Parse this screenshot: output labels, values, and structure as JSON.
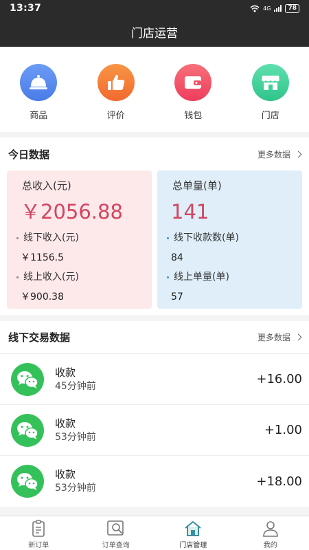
{
  "status_bar": {
    "time": "13:37",
    "network": "4G",
    "battery": "78"
  },
  "header": {
    "title": "门店运营"
  },
  "quick_actions": [
    {
      "label": "商品",
      "icon": "dome-icon",
      "color": "#5b8ef0"
    },
    {
      "label": "评价",
      "icon": "thumbs-up-icon",
      "color": "#f57f3a"
    },
    {
      "label": "钱包",
      "icon": "wallet-icon",
      "color": "#f2526a"
    },
    {
      "label": "门店",
      "icon": "store-icon",
      "color": "#3fd09a"
    }
  ],
  "today": {
    "title": "今日数据",
    "more": "更多数据",
    "income": {
      "title": "总收入(元)",
      "value": "￥2056.88",
      "offline_label": "线下收入(元)",
      "offline_value": "￥1156.5",
      "online_label": "线上收入(元)",
      "online_value": "￥900.38"
    },
    "orders": {
      "title": "总单量(单)",
      "value": "141",
      "offline_label": "线下收款数(单)",
      "offline_value": "84",
      "online_label": "线上单量(单)",
      "online_value": "57"
    }
  },
  "offline": {
    "title": "线下交易数据",
    "more": "更多数据",
    "transactions": [
      {
        "title": "收款",
        "time": "45分钟前",
        "amount": "+16.00"
      },
      {
        "title": "收款",
        "time": "53分钟前",
        "amount": "+1.00"
      },
      {
        "title": "收款",
        "time": "53分钟前",
        "amount": "+18.00"
      }
    ]
  },
  "tabs": [
    {
      "label": "新订单",
      "icon": "document-icon"
    },
    {
      "label": "订单查询",
      "icon": "search-list-icon"
    },
    {
      "label": "门店管理",
      "icon": "home-icon",
      "active": true
    },
    {
      "label": "我的",
      "icon": "user-icon"
    }
  ],
  "colors": {
    "header": "#2b2b2b",
    "accent": "#d14560",
    "wechat_green": "#35c15a",
    "active_tab": "#3a8fa0"
  }
}
